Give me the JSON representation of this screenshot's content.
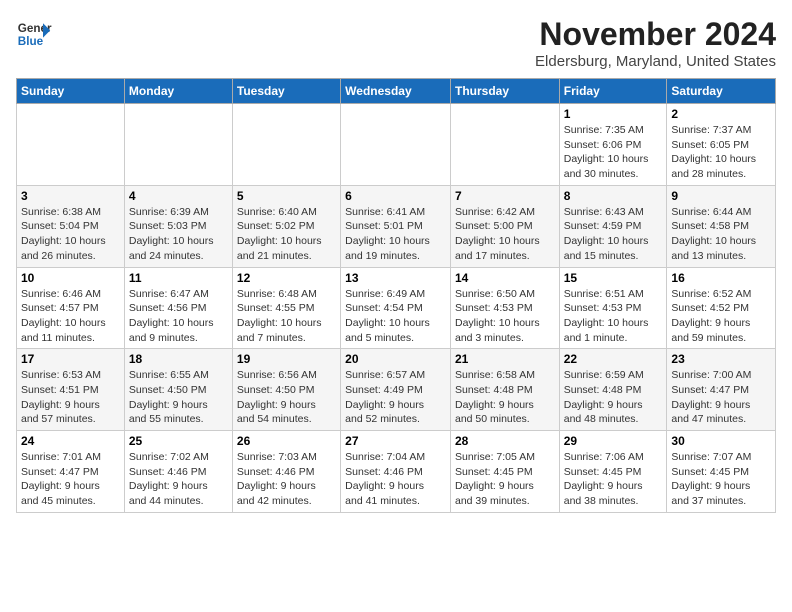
{
  "header": {
    "logo_general": "General",
    "logo_blue": "Blue",
    "month": "November 2024",
    "location": "Eldersburg, Maryland, United States"
  },
  "days_of_week": [
    "Sunday",
    "Monday",
    "Tuesday",
    "Wednesday",
    "Thursday",
    "Friday",
    "Saturday"
  ],
  "weeks": [
    [
      {
        "day": "",
        "info": ""
      },
      {
        "day": "",
        "info": ""
      },
      {
        "day": "",
        "info": ""
      },
      {
        "day": "",
        "info": ""
      },
      {
        "day": "",
        "info": ""
      },
      {
        "day": "1",
        "info": "Sunrise: 7:35 AM\nSunset: 6:06 PM\nDaylight: 10 hours\nand 30 minutes."
      },
      {
        "day": "2",
        "info": "Sunrise: 7:37 AM\nSunset: 6:05 PM\nDaylight: 10 hours\nand 28 minutes."
      }
    ],
    [
      {
        "day": "3",
        "info": "Sunrise: 6:38 AM\nSunset: 5:04 PM\nDaylight: 10 hours\nand 26 minutes."
      },
      {
        "day": "4",
        "info": "Sunrise: 6:39 AM\nSunset: 5:03 PM\nDaylight: 10 hours\nand 24 minutes."
      },
      {
        "day": "5",
        "info": "Sunrise: 6:40 AM\nSunset: 5:02 PM\nDaylight: 10 hours\nand 21 minutes."
      },
      {
        "day": "6",
        "info": "Sunrise: 6:41 AM\nSunset: 5:01 PM\nDaylight: 10 hours\nand 19 minutes."
      },
      {
        "day": "7",
        "info": "Sunrise: 6:42 AM\nSunset: 5:00 PM\nDaylight: 10 hours\nand 17 minutes."
      },
      {
        "day": "8",
        "info": "Sunrise: 6:43 AM\nSunset: 4:59 PM\nDaylight: 10 hours\nand 15 minutes."
      },
      {
        "day": "9",
        "info": "Sunrise: 6:44 AM\nSunset: 4:58 PM\nDaylight: 10 hours\nand 13 minutes."
      }
    ],
    [
      {
        "day": "10",
        "info": "Sunrise: 6:46 AM\nSunset: 4:57 PM\nDaylight: 10 hours\nand 11 minutes."
      },
      {
        "day": "11",
        "info": "Sunrise: 6:47 AM\nSunset: 4:56 PM\nDaylight: 10 hours\nand 9 minutes."
      },
      {
        "day": "12",
        "info": "Sunrise: 6:48 AM\nSunset: 4:55 PM\nDaylight: 10 hours\nand 7 minutes."
      },
      {
        "day": "13",
        "info": "Sunrise: 6:49 AM\nSunset: 4:54 PM\nDaylight: 10 hours\nand 5 minutes."
      },
      {
        "day": "14",
        "info": "Sunrise: 6:50 AM\nSunset: 4:53 PM\nDaylight: 10 hours\nand 3 minutes."
      },
      {
        "day": "15",
        "info": "Sunrise: 6:51 AM\nSunset: 4:53 PM\nDaylight: 10 hours\nand 1 minute."
      },
      {
        "day": "16",
        "info": "Sunrise: 6:52 AM\nSunset: 4:52 PM\nDaylight: 9 hours\nand 59 minutes."
      }
    ],
    [
      {
        "day": "17",
        "info": "Sunrise: 6:53 AM\nSunset: 4:51 PM\nDaylight: 9 hours\nand 57 minutes."
      },
      {
        "day": "18",
        "info": "Sunrise: 6:55 AM\nSunset: 4:50 PM\nDaylight: 9 hours\nand 55 minutes."
      },
      {
        "day": "19",
        "info": "Sunrise: 6:56 AM\nSunset: 4:50 PM\nDaylight: 9 hours\nand 54 minutes."
      },
      {
        "day": "20",
        "info": "Sunrise: 6:57 AM\nSunset: 4:49 PM\nDaylight: 9 hours\nand 52 minutes."
      },
      {
        "day": "21",
        "info": "Sunrise: 6:58 AM\nSunset: 4:48 PM\nDaylight: 9 hours\nand 50 minutes."
      },
      {
        "day": "22",
        "info": "Sunrise: 6:59 AM\nSunset: 4:48 PM\nDaylight: 9 hours\nand 48 minutes."
      },
      {
        "day": "23",
        "info": "Sunrise: 7:00 AM\nSunset: 4:47 PM\nDaylight: 9 hours\nand 47 minutes."
      }
    ],
    [
      {
        "day": "24",
        "info": "Sunrise: 7:01 AM\nSunset: 4:47 PM\nDaylight: 9 hours\nand 45 minutes."
      },
      {
        "day": "25",
        "info": "Sunrise: 7:02 AM\nSunset: 4:46 PM\nDaylight: 9 hours\nand 44 minutes."
      },
      {
        "day": "26",
        "info": "Sunrise: 7:03 AM\nSunset: 4:46 PM\nDaylight: 9 hours\nand 42 minutes."
      },
      {
        "day": "27",
        "info": "Sunrise: 7:04 AM\nSunset: 4:46 PM\nDaylight: 9 hours\nand 41 minutes."
      },
      {
        "day": "28",
        "info": "Sunrise: 7:05 AM\nSunset: 4:45 PM\nDaylight: 9 hours\nand 39 minutes."
      },
      {
        "day": "29",
        "info": "Sunrise: 7:06 AM\nSunset: 4:45 PM\nDaylight: 9 hours\nand 38 minutes."
      },
      {
        "day": "30",
        "info": "Sunrise: 7:07 AM\nSunset: 4:45 PM\nDaylight: 9 hours\nand 37 minutes."
      }
    ]
  ]
}
